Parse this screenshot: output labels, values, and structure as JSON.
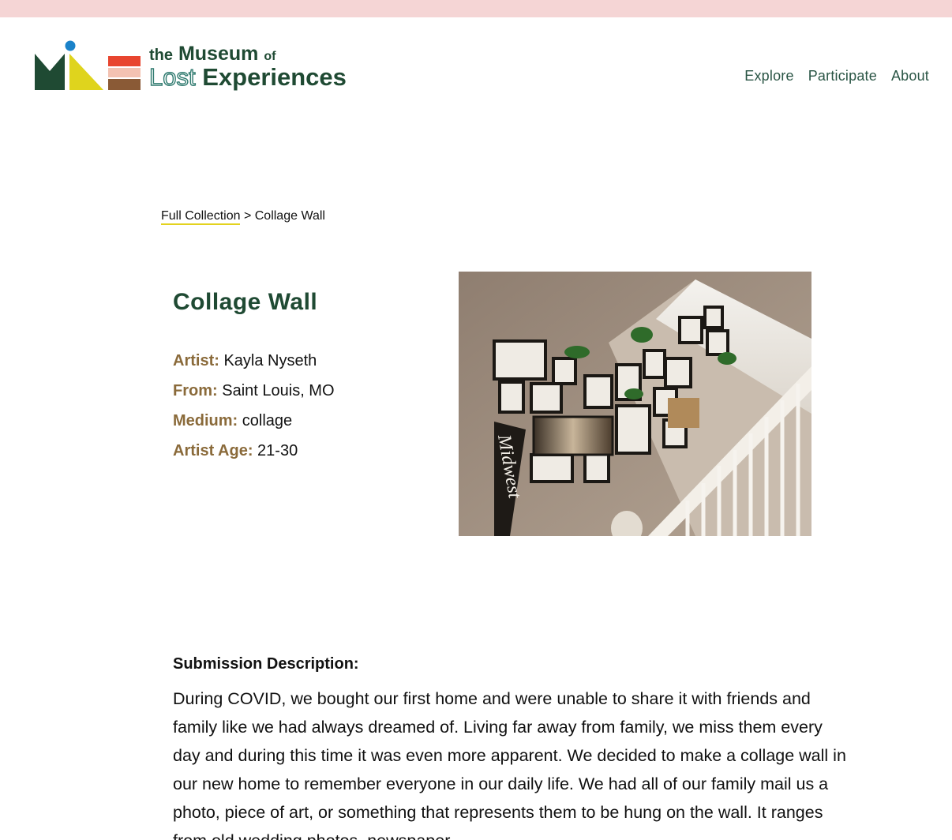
{
  "banner": {
    "color": "#f5d5d5"
  },
  "logo": {
    "the": "the",
    "museum": "Museum",
    "of": "of",
    "lost": "Lost",
    "experiences": "Experiences",
    "colors": {
      "green": "#1f4a33",
      "blue": "#1a82c9",
      "yellow": "#dfd41d",
      "red": "#e8452f",
      "pink": "#f3c2b2",
      "brown": "#8a5a36",
      "teal": "#2f7a6f"
    }
  },
  "nav": {
    "items": [
      {
        "label": "Explore"
      },
      {
        "label": "Participate"
      },
      {
        "label": "About"
      }
    ]
  },
  "breadcrumb": {
    "link": "Full Collection",
    "separator": ">",
    "current": "Collage Wall"
  },
  "artwork": {
    "title": "Collage Wall",
    "artist_label": "Artist:",
    "artist": "Kayla Nyseth",
    "from_label": "From:",
    "from": "Saint Louis, MO",
    "medium_label": "Medium:",
    "medium": "collage",
    "age_label": "Artist Age:",
    "age": "21-30",
    "pennant_text": "Midwest"
  },
  "description": {
    "heading": "Submission Description:",
    "body": "During COVID, we bought our first home and were unable to share it with friends and family like we had always dreamed of. Living far away from family, we miss them every day and during this time it was even more apparent. We decided to make a collage wall in our new home to remember everyone in our daily life. We had all of our family mail us a photo, piece of art, or something that represents them to be hung on the wall. It ranges from old wedding photos, newspaper"
  },
  "theme": {
    "accent_brown": "#8a6a3a",
    "accent_green": "#1f4a33",
    "underline_yellow": "#e3d21e"
  }
}
